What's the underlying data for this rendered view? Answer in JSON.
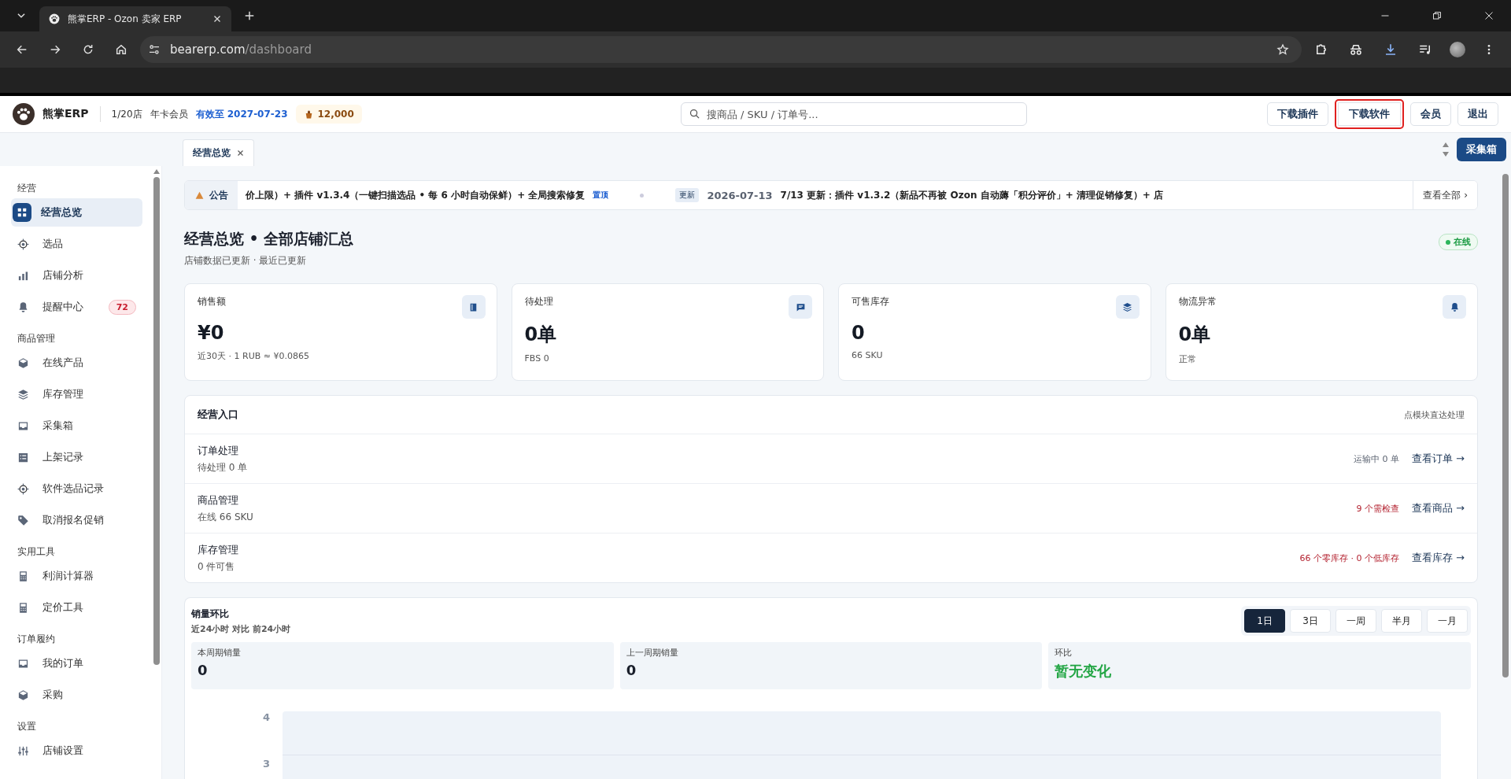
{
  "browser": {
    "tab_title": "熊掌ERP - Ozon 卖家 ERP",
    "url_host": "bearerp.com",
    "url_path": "/dashboard"
  },
  "header": {
    "brand": "熊掌ERP",
    "stores": "1/20店",
    "plan": "年卡会员",
    "expiry": "有效至 2027-07-23",
    "points": "12,000",
    "search_placeholder": "搜商品 / SKU / 订单号...",
    "buttons": [
      {
        "label": "下载插件",
        "highlighted": false
      },
      {
        "label": "下载软件",
        "highlighted": true
      },
      {
        "label": "会员",
        "highlighted": false
      },
      {
        "label": "退出",
        "highlighted": false
      }
    ]
  },
  "page_tabs": [
    {
      "label": "经营总览",
      "selected": true
    }
  ],
  "collect_button": "采集箱",
  "sidebar": {
    "sections": [
      {
        "title": "经营",
        "items": [
          {
            "label": "经营总览",
            "selected": true
          },
          {
            "label": "选品",
            "selected": false
          },
          {
            "label": "店铺分析",
            "selected": false
          },
          {
            "label": "提醒中心",
            "selected": false,
            "badge": "72"
          }
        ]
      },
      {
        "title": "商品管理",
        "items": [
          {
            "label": "在线产品",
            "selected": false
          },
          {
            "label": "库存管理",
            "selected": false
          },
          {
            "label": "采集箱",
            "selected": false
          },
          {
            "label": "上架记录",
            "selected": false
          },
          {
            "label": "软件选品记录",
            "selected": false
          },
          {
            "label": "取消报名促销",
            "selected": false
          }
        ]
      },
      {
        "title": "实用工具",
        "items": [
          {
            "label": "利润计算器",
            "selected": false
          },
          {
            "label": "定价工具",
            "selected": false
          }
        ]
      },
      {
        "title": "订单履约",
        "items": [
          {
            "label": "我的订单",
            "selected": false
          },
          {
            "label": "采购",
            "selected": false
          }
        ]
      },
      {
        "title": "设置",
        "items": [
          {
            "label": "店铺设置",
            "selected": false
          }
        ]
      }
    ]
  },
  "announcement": {
    "label": "公告",
    "segments": [
      {
        "text": "价上限）+ 插件 v1.3.4（一键扫描选品 • 每 6 小时自动保鲜）+ 全局搜索修复",
        "tag": "置顶"
      },
      {
        "badge": "更新",
        "date": "2026-07-13",
        "text": "7/13 更新：插件 v1.3.2（新品不再被 Ozon 自动薅「积分评价」+ 清理促销修复）+ 店"
      }
    ],
    "view_all": "查看全部 ›"
  },
  "title": "经营总览 • 全部店铺汇总",
  "subtitle": "店铺数据已更新 · 最近已更新",
  "status": "在线",
  "stat_cards": [
    {
      "label": "销售额",
      "value": "¥0",
      "note": "近30天 · 1 RUB ≈ ¥0.0865"
    },
    {
      "label": "待处理",
      "value": "0单",
      "note": "FBS 0"
    },
    {
      "label": "可售库存",
      "value": "0",
      "note": "66 SKU"
    },
    {
      "label": "物流异常",
      "value": "0单",
      "note": "正常"
    }
  ],
  "entries": {
    "title": "经营入口",
    "hint": "点模块直达处理",
    "rows": [
      {
        "name": "订单处理",
        "detail": "待处理 0 单",
        "status": "运输中 0 单",
        "alert": false,
        "link": "查看订单 →"
      },
      {
        "name": "商品管理",
        "detail": "在线 66 SKU",
        "status": "9 个需检查",
        "alert": true,
        "link": "查看商品 →"
      },
      {
        "name": "库存管理",
        "detail": "0 件可售",
        "status": "66 个零库存 · 0 个低库存",
        "alert": true,
        "link": "查看库存 →"
      }
    ]
  },
  "sales": {
    "title": "销量环比",
    "subtitle": "近24小时 对比 前24小时",
    "ranges": [
      {
        "label": "1日",
        "selected": true
      },
      {
        "label": "3日",
        "selected": false
      },
      {
        "label": "一周",
        "selected": false
      },
      {
        "label": "半月",
        "selected": false
      },
      {
        "label": "一月",
        "selected": false
      }
    ],
    "metrics": [
      {
        "label": "本周期销量",
        "value": "0",
        "kind": "number"
      },
      {
        "label": "上一周期销量",
        "value": "0",
        "kind": "number"
      },
      {
        "label": "环比",
        "value": "暂无变化",
        "kind": "trend"
      }
    ],
    "y_ticks": [
      "4",
      "3"
    ]
  }
}
